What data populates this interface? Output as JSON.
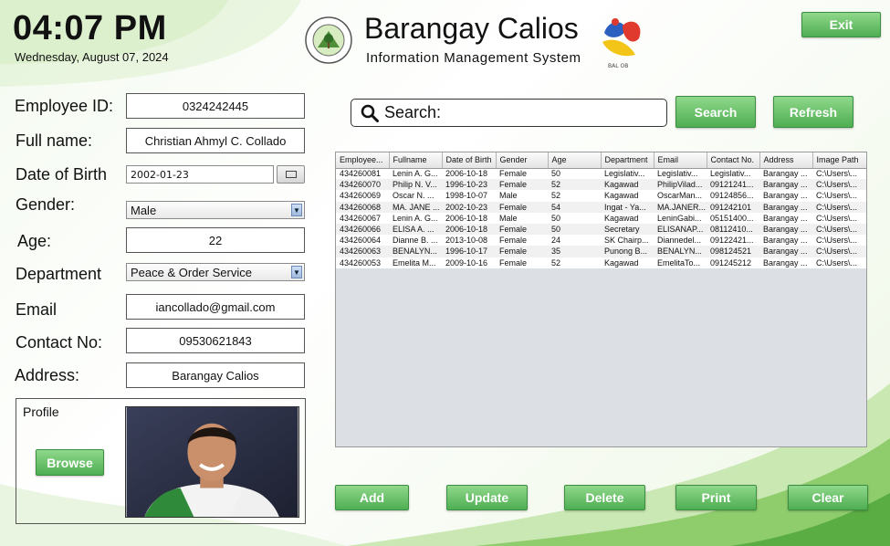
{
  "clock": {
    "time": "04:07 PM",
    "date": "Wednesday, August 07, 2024"
  },
  "header": {
    "title": "Barangay Calios",
    "subtitle": "Information Management System",
    "seal_text": "BARANGAY CALIOS STA.CRUZ, LAGUNA",
    "logo_text": "BAL OB"
  },
  "buttons": {
    "exit": "Exit",
    "search": "Search",
    "refresh": "Refresh",
    "browse": "Browse",
    "add": "Add",
    "update": "Update",
    "delete": "Delete",
    "print": "Print",
    "clear": "Clear"
  },
  "form": {
    "employee_id": {
      "label": "Employee ID:",
      "value": "0324242445"
    },
    "full_name": {
      "label": "Full name:",
      "value": "Christian Ahmyl C. Collado"
    },
    "dob": {
      "label": "Date of Birth",
      "value": "2002-01-23"
    },
    "gender": {
      "label": "Gender:",
      "value": "Male"
    },
    "age": {
      "label": "Age:",
      "value": "22"
    },
    "department": {
      "label": "Department",
      "value": "Peace & Order Service"
    },
    "email": {
      "label": "Email",
      "value": "iancollado@gmail.com"
    },
    "contact": {
      "label": "Contact No:",
      "value": "09530621843"
    },
    "address": {
      "label": "Address:",
      "value": "Barangay Calios"
    },
    "profile": {
      "label": "Profile"
    }
  },
  "search": {
    "label": "Search:"
  },
  "table": {
    "columns": [
      "Employee...",
      "Fullname",
      "Date of Birth",
      "Gender",
      "Age",
      "Department",
      "Email",
      "Contact No.",
      "Address",
      "Image Path"
    ],
    "rows": [
      [
        "434260081",
        "Lenin A. G...",
        "2006-10-18",
        "Female",
        "50",
        "Legislativ...",
        "Legislativ...",
        "Legislativ...",
        "Barangay ...",
        "C:\\Users\\..."
      ],
      [
        "434260070",
        "Philip N. V...",
        "1996-10-23",
        "Female",
        "52",
        "Kagawad",
        "PhilipVilad...",
        "09121241...",
        "Barangay ...",
        "C:\\Users\\..."
      ],
      [
        "434260069",
        "Oscar N. ...",
        "1998-10-07",
        "Male",
        "52",
        "Kagawad",
        "OscarMan...",
        "09124856...",
        "Barangay ...",
        "C:\\Users\\..."
      ],
      [
        "434260068",
        "MA. JANE ...",
        "2002-10-23",
        "Female",
        "54",
        "Ingat - Ya...",
        "MA.JANER...",
        "091242101",
        "Barangay ...",
        "C:\\Users\\..."
      ],
      [
        "434260067",
        "Lenin A. G...",
        "2006-10-18",
        "Male",
        "50",
        "Kagawad",
        "LeninGabi...",
        "05151400...",
        "Barangay ...",
        "C:\\Users\\..."
      ],
      [
        "434260066",
        "ELISA A. ...",
        "2006-10-18",
        "Female",
        "50",
        "Secretary",
        "ELISANAP...",
        "08112410...",
        "Barangay ...",
        "C:\\Users\\..."
      ],
      [
        "434260064",
        "Dianne B. ...",
        "2013-10-08",
        "Female",
        "24",
        "SK Chairp...",
        "Diannedel...",
        "09122421...",
        "Barangay ...",
        "C:\\Users\\..."
      ],
      [
        "434260063",
        "BENALYN...",
        "1996-10-17",
        "Female",
        "35",
        "Punong B...",
        "BENALYN...",
        "098124521",
        "Barangay ...",
        "C:\\Users\\..."
      ],
      [
        "434260053",
        "Emelita M...",
        "2009-10-16",
        "Female",
        "52",
        "Kagawad",
        "EmelitaTo...",
        "091245212",
        " Barangay ...",
        "C:\\Users\\..."
      ]
    ]
  },
  "colors": {
    "button_green": "#5cb85c",
    "accent_green": "#8ccf6a"
  },
  "icons": {
    "search": "magnifier-icon",
    "calendar": "calendar-icon",
    "dropdown": "chevron-down-icon"
  }
}
